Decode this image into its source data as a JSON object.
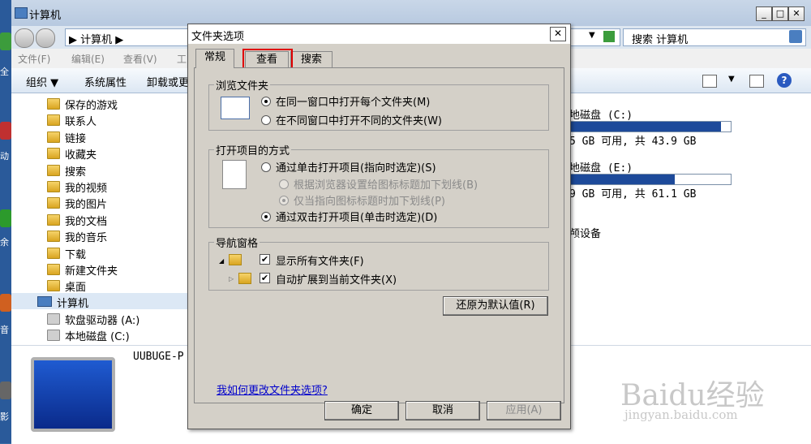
{
  "explorer": {
    "title": "计算机",
    "address": "▶ 计算机 ▶",
    "search_placeholder": "搜索 计算机",
    "menu": [
      "文件(F)",
      "编辑(E)",
      "查看(V)",
      "工"
    ],
    "toolbar": {
      "organize": "组织 ▼",
      "system_props": "系统属性",
      "uninstall": "卸载或更"
    },
    "nav_items": [
      "保存的游戏",
      "联系人",
      "链接",
      "收藏夹",
      "搜索",
      "我的视频",
      "我的图片",
      "我的文档",
      "我的音乐",
      "下载",
      "新建文件夹",
      "桌面",
      "计算机",
      "软盘驱动器 (A:)",
      "本地磁盘 (C:)"
    ],
    "drives": [
      {
        "name": "地磁盘 (C:)",
        "info": "5 GB 可用, 共 43.9 GB",
        "used_fraction": 0.94
      },
      {
        "name": "地磁盘 (E:)",
        "info": "9 GB 可用, 共 61.1 GB",
        "used_fraction": 0.65
      }
    ],
    "other_device": "颅设备",
    "computer_name": "UUBUGE-P"
  },
  "desktop_fragments": [
    "全",
    "动",
    "余",
    "音",
    "影"
  ],
  "dialog": {
    "title": "文件夹选项",
    "close": "✕",
    "tabs": [
      "常规",
      "查看",
      "搜索"
    ],
    "browse_group": {
      "label": "浏览文件夹",
      "options": [
        "在同一窗口中打开每个文件夹(M)",
        "在不同窗口中打开不同的文件夹(W)"
      ]
    },
    "click_group": {
      "label": "打开项目的方式",
      "single": "通过单击打开项目(指向时选定)(S)",
      "sub1": "根据浏览器设置给图标标题加下划线(B)",
      "sub2": "仅当指向图标标题时加下划线(P)",
      "double": "通过双击打开项目(单击时选定)(D)"
    },
    "nav_group": {
      "label": "导航窗格",
      "show_all": "显示所有文件夹(F)",
      "auto_expand": "自动扩展到当前文件夹(X)"
    },
    "restore_button": "还原为默认值(R)",
    "help_link": "我如何更改文件夹选项?",
    "ok": "确定",
    "cancel": "取消",
    "apply": "应用(A)"
  },
  "watermark": {
    "brand": "Baidu经验",
    "url": "jingyan.baidu.com"
  }
}
